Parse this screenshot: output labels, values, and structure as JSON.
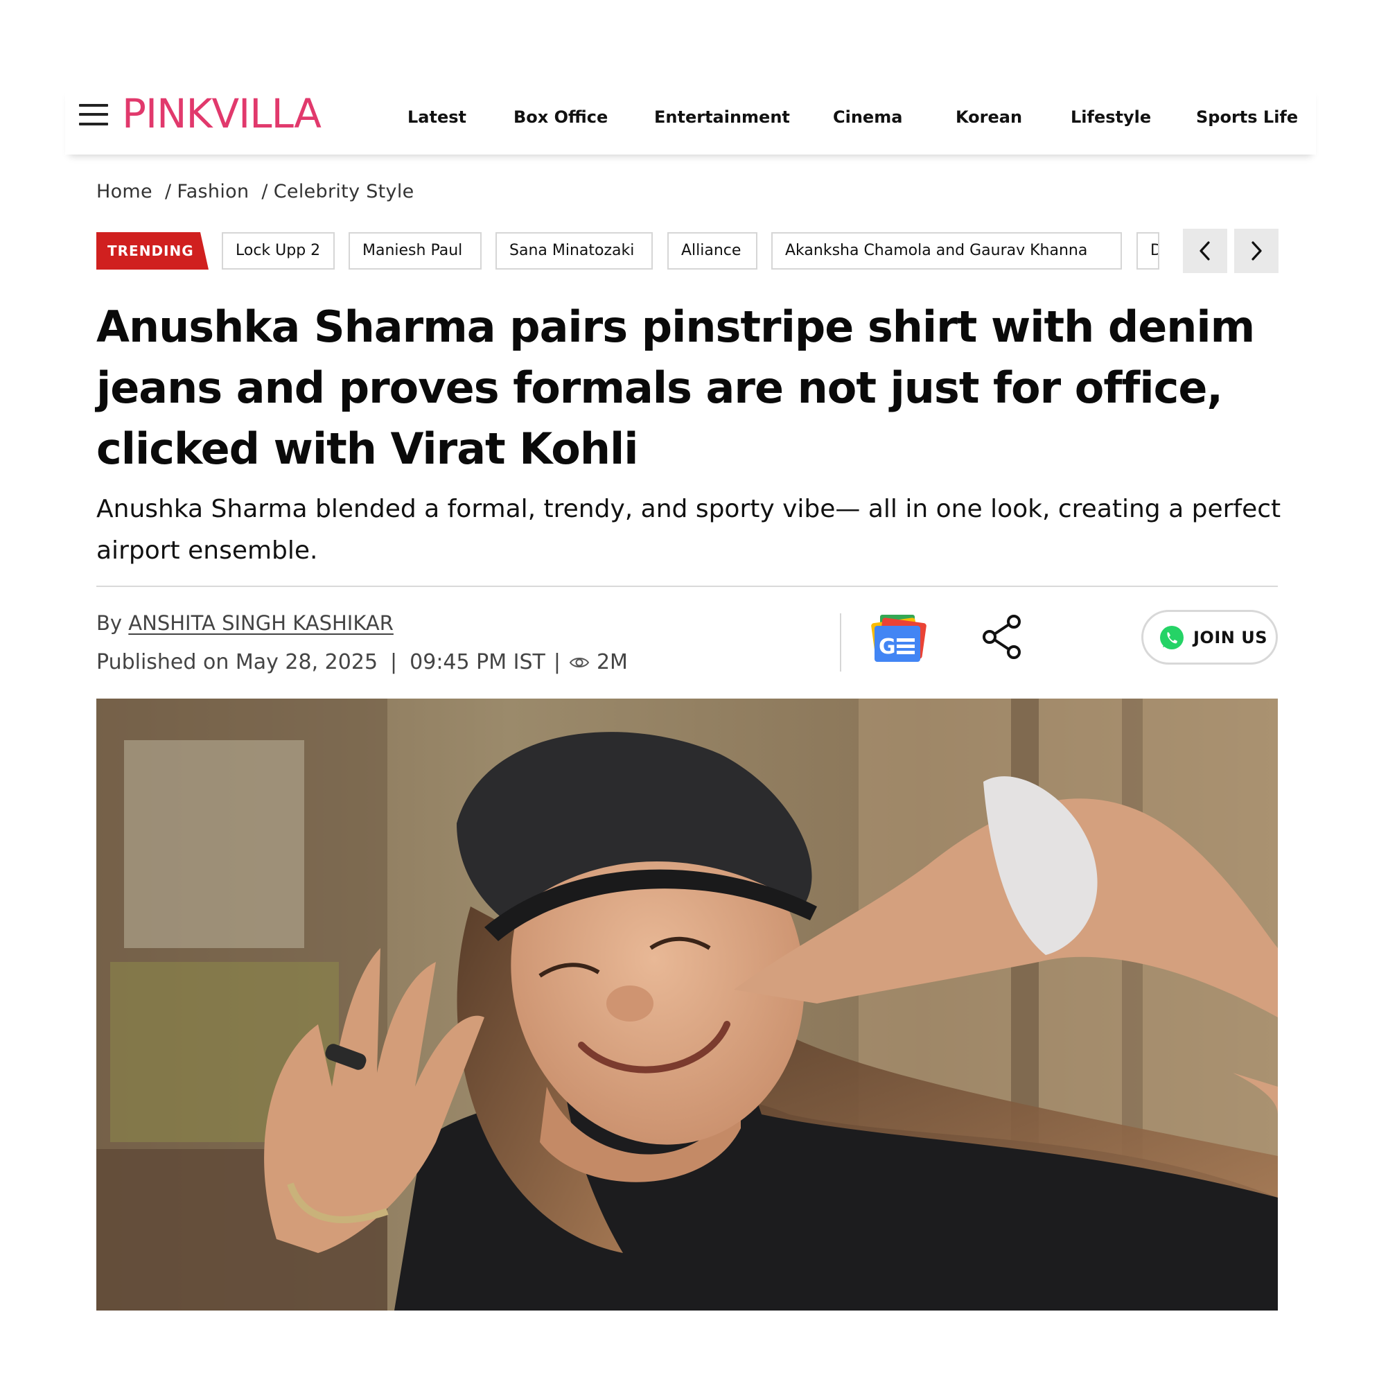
{
  "brand": {
    "logo_text": "PINKVILLA",
    "color": "#e1396c"
  },
  "nav": {
    "items": [
      {
        "label": "Latest"
      },
      {
        "label": "Box Office"
      },
      {
        "label": "Entertainment"
      },
      {
        "label": "Cinema"
      },
      {
        "label": "Korean"
      },
      {
        "label": "Lifestyle"
      },
      {
        "label": "Sports Life"
      }
    ]
  },
  "breadcrumb": {
    "items": [
      "Home",
      "Fashion",
      "Celebrity Style"
    ],
    "separator": "/"
  },
  "trending": {
    "badge": "TRENDING",
    "badge_color": "#d0201f",
    "tags": [
      "Lock Upp 2",
      "Maniesh Paul",
      "Sana Minatozaki",
      "Alliance",
      "Akanksha Chamola and Gaurav Khanna",
      "D"
    ]
  },
  "article": {
    "headline": "Anushka Sharma pairs pinstripe shirt with denim jeans and proves formals are not just for office, clicked with Virat Kohli",
    "subheadline": "Anushka Sharma blended a formal, trendy, and sporty vibe— all in one look, creating a perfect airport ensemble.",
    "by_prefix": "By",
    "author": "ANSHITA SINGH KASHIKAR",
    "published_label": "Published on May 28, 2025",
    "sep": "|",
    "time": "09:45 PM IST",
    "views": "2M"
  },
  "actions": {
    "join_label": "JOIN US",
    "gnews_icon": "google-news-icon",
    "share_icon": "share-icon",
    "whatsapp_icon": "whatsapp-icon"
  }
}
